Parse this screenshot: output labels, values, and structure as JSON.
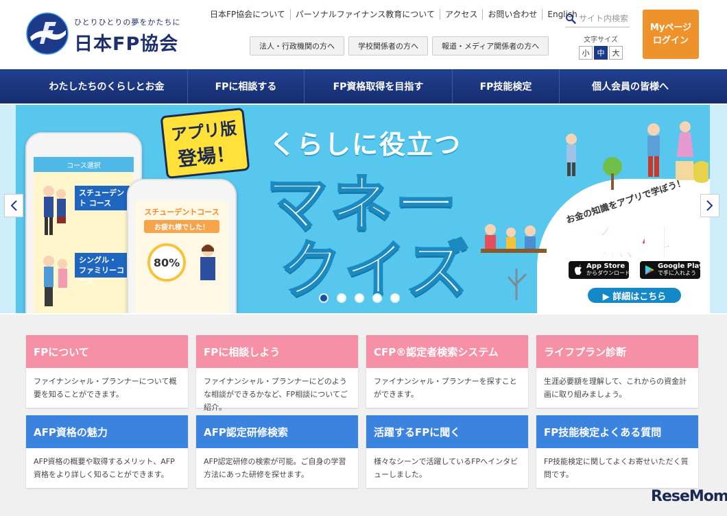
{
  "header": {
    "tagline": "ひとりひとりの夢をかたちに",
    "org_name": "日本FP協会",
    "util_links": [
      "日本FP協会について",
      "パーソナルファイナンス教育について",
      "アクセス",
      "お問い合わせ",
      "English"
    ],
    "search_placeholder": "サイト内検索",
    "audience_buttons": [
      "法人・行政機関の方へ",
      "学校関係者の方へ",
      "報道・メディア関係者の方へ"
    ],
    "fontsize_label": "文字サイズ",
    "fontsize_options": [
      "小",
      "中",
      "大"
    ],
    "mypage_line1": "Myページ",
    "mypage_line2": "ログイン"
  },
  "nav": [
    "わたしたちのくらしとお金",
    "FPに相談する",
    "FP資格取得を目指す",
    "FP技能検定",
    "個人会員の皆様へ"
  ],
  "hero": {
    "badge_line1": "アプリ版",
    "badge_line2": "登場！",
    "title_small": "くらしに役立つ",
    "title_line1": "マネー",
    "title_line2": "クイズ",
    "subtitle": "お金の知識をアプリで学ぼう！",
    "free": "無料",
    "app_store_top": "App Store",
    "app_store_bottom": "からダウンロード",
    "google_play_top": "Google Play",
    "google_play_bottom": "で手に入れよう",
    "detail_button": "▶ 詳細はこちら",
    "phone1_header": "コース選択",
    "phone1_course1": "スチューデント コース",
    "phone1_course2": "シングル・ ファミリーコース",
    "phone2_title": "スチューデントコース",
    "phone2_sub": "お疲れ様でした！",
    "phone2_score": "80%",
    "slide_count": 5,
    "active_slide": 0
  },
  "cards": [
    {
      "title": "FPについて",
      "desc": "ファイナンシャル・プランナーについて概要を知ることができます。",
      "color": "pink"
    },
    {
      "title": "FPに相談しよう",
      "desc": "ファイナンシャル・プランナーにどのような相談ができるかなど、FP相談についてご紹介。",
      "color": "pink"
    },
    {
      "title": "CFP®認定者検索システム",
      "desc": "ファイナンシャル・プランナーを探すことができます。",
      "color": "pink"
    },
    {
      "title": "ライフプラン診断",
      "desc": "生涯必要額を理解して、これからの資金計画に取り組みましょう。",
      "color": "pink"
    },
    {
      "title": "AFP資格の魅力",
      "desc": "AFP資格の概要や取得するメリット、AFP資格をより詳しく知ることができます。",
      "color": "blue"
    },
    {
      "title": "AFP認定研修検索",
      "desc": "AFP認定研修の検索が可能。ご自身の学習方法にあった研修を探せます。",
      "color": "blue"
    },
    {
      "title": "活躍するFPに聞く",
      "desc": "様々なシーンで活躍しているFPへインタビューしました。",
      "color": "blue"
    },
    {
      "title": "FP技能検定よくある質問",
      "desc": "FP技能検定に関してよくお寄せいただく質問です。",
      "color": "blue"
    }
  ],
  "watermark": "ReseMom",
  "colors": {
    "navy": "#1d2f6f",
    "orange": "#f0922b",
    "pink": "#f590a6",
    "blue": "#3a84e0",
    "sky": "#58c7ee"
  }
}
